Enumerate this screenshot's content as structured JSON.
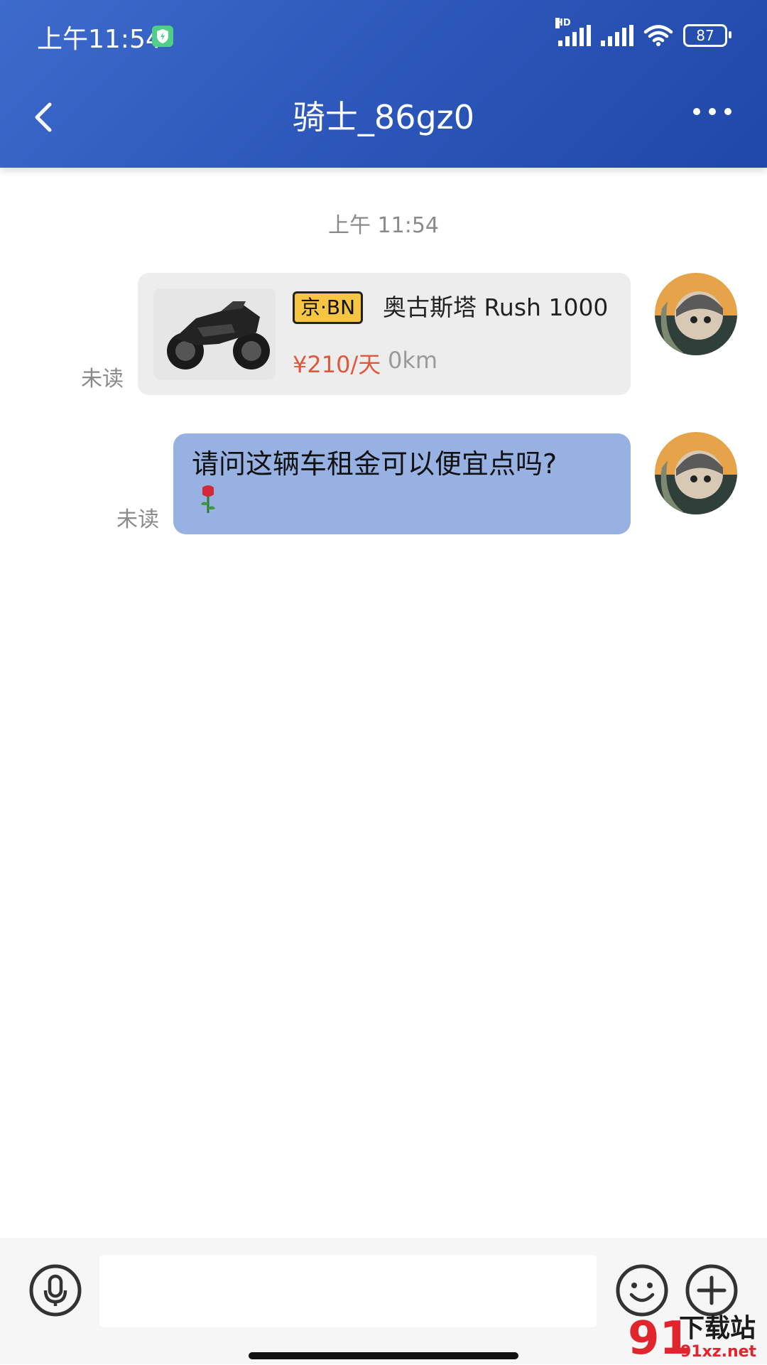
{
  "status_bar": {
    "time": "上午11:54",
    "battery": "87",
    "network_label": "HD"
  },
  "header": {
    "title": "骑士_86gz0",
    "back_icon": "chevron-left-icon",
    "more_icon": "more-dots-icon"
  },
  "chat": {
    "timestamp": "上午 11:54",
    "messages": [
      {
        "type": "product_card",
        "plate": "京·BN",
        "name": "奥古斯塔 Rush 1000",
        "price": "¥210/天",
        "mileage": "0km",
        "status": "未读"
      },
      {
        "type": "text",
        "text": "请问这辆车租金可以便宜点吗?",
        "emoji": "rose-emoji",
        "status": "未读"
      }
    ]
  },
  "input_bar": {
    "voice_icon": "microphone-icon",
    "emoji_icon": "smiley-icon",
    "add_icon": "plus-icon"
  },
  "watermark": {
    "num": "91",
    "text": "下载站",
    "domain": "91xz.net"
  },
  "colors": {
    "header": "#2b55b8",
    "bubble": "#97b2e2",
    "price": "#e1573b",
    "plate": "#f6c642"
  }
}
